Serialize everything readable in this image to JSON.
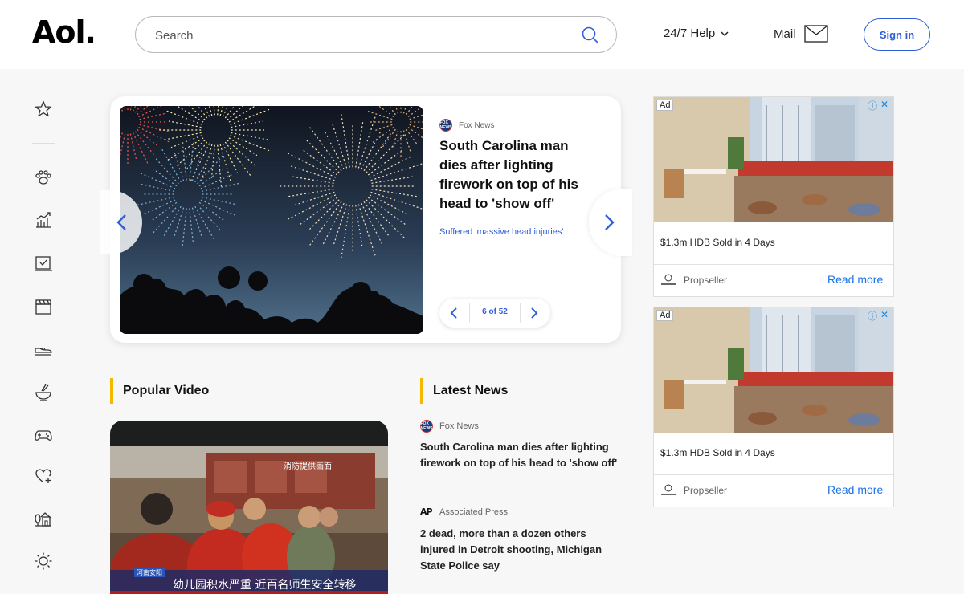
{
  "header": {
    "logo": "Aol.",
    "search_placeholder": "Search",
    "help_label": "24/7 Help",
    "mail_label": "Mail",
    "signin_label": "Sign in"
  },
  "sidebar": {
    "icons": [
      "star-icon",
      "paw-icon",
      "chart-icon",
      "checkbox-icon",
      "clapper-icon",
      "shoe-icon",
      "bowl-icon",
      "gamepad-icon",
      "heart-plus-icon",
      "house-tree-icon",
      "sun-icon"
    ]
  },
  "carousel": {
    "source": "Fox News",
    "source_badge": "FOX NEWS",
    "headline": "South Carolina man dies after lighting firework on top of his head to 'show off'",
    "subtitle": "Suffered 'massive head injuries'",
    "pager": "6 of 52"
  },
  "sections": {
    "popular_video": "Popular Video",
    "latest_news": "Latest News"
  },
  "video": {
    "caption_tag": "河南安阳",
    "caption": "幼儿园积水严重  近百名师生安全转移",
    "corner_label": "消防提供画面"
  },
  "latest_news": [
    {
      "source": "Fox News",
      "badge": "FOX NEWS",
      "headline": "South Carolina man dies after lighting firework on top of his head to 'show off'"
    },
    {
      "source": "Associated Press",
      "badge": "AP",
      "headline": "2 dead, more than a dozen others injured in Detroit shooting, Michigan State Police say"
    }
  ],
  "ads": [
    {
      "label": "Ad",
      "title": "$1.3m HDB Sold in 4 Days",
      "sponsor": "Propseller",
      "cta": "Read more"
    },
    {
      "label": "Ad",
      "title": "$1.3m HDB Sold in 4 Days",
      "sponsor": "Propseller",
      "cta": "Read more"
    }
  ],
  "colors": {
    "accent_blue": "#2d5fd8",
    "section_bar": "#f5b800",
    "ad_link": "#1a73e8"
  }
}
